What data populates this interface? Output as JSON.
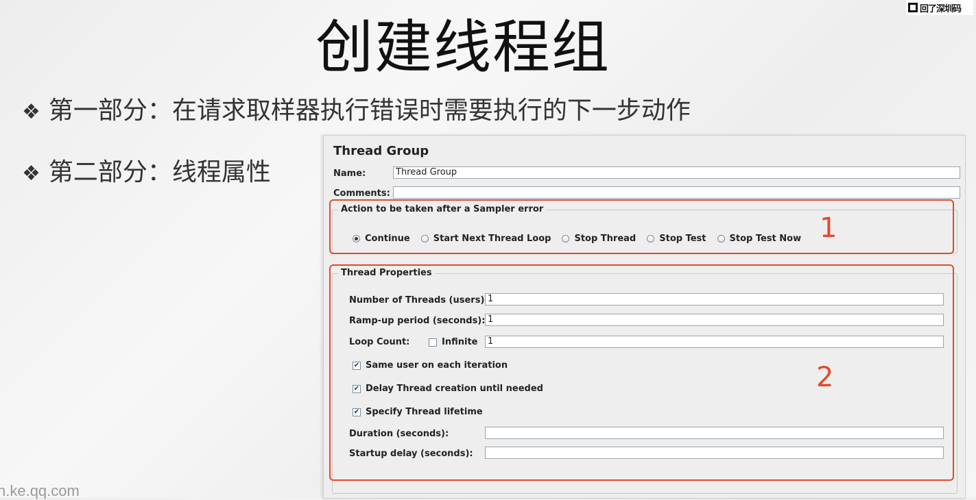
{
  "slide": {
    "title": "创建线程组",
    "bullet_marker": "❖",
    "bullets": [
      "第一部分：在请求取样器执行错误时需要执行的下一步动作",
      "第二部分：线程属性"
    ],
    "footer_url": "n.ke.qq.com",
    "qr_label": "回了深圳码"
  },
  "panel": {
    "title": "Thread Group",
    "name_label": "Name:",
    "name_value": "Thread Group",
    "comments_label": "Comments:",
    "comments_value": "",
    "sampler_error": {
      "legend": "Action to be taken after a Sampler error",
      "options": [
        "Continue",
        "Start Next Thread Loop",
        "Stop Thread",
        "Stop Test",
        "Stop Test Now"
      ],
      "selected": "Continue"
    },
    "thread_properties": {
      "legend": "Thread Properties",
      "threads_label": "Number of Threads (users):",
      "threads_value": "1",
      "rampup_label": "Ramp-up period (seconds):",
      "rampup_value": "1",
      "loop_label": "Loop Count:",
      "infinite_label": "Infinite",
      "infinite_checked": false,
      "loop_value": "1",
      "same_user_label": "Same user on each iteration",
      "same_user_checked": true,
      "delay_label": "Delay Thread creation until needed",
      "delay_checked": true,
      "lifetime_label": "Specify Thread lifetime",
      "lifetime_checked": true,
      "duration_label": "Duration (seconds):",
      "duration_value": "",
      "startup_label": "Startup delay (seconds):",
      "startup_value": ""
    }
  },
  "annotations": {
    "box1_number": "1",
    "box2_number": "2",
    "color": "#e24a2c"
  }
}
